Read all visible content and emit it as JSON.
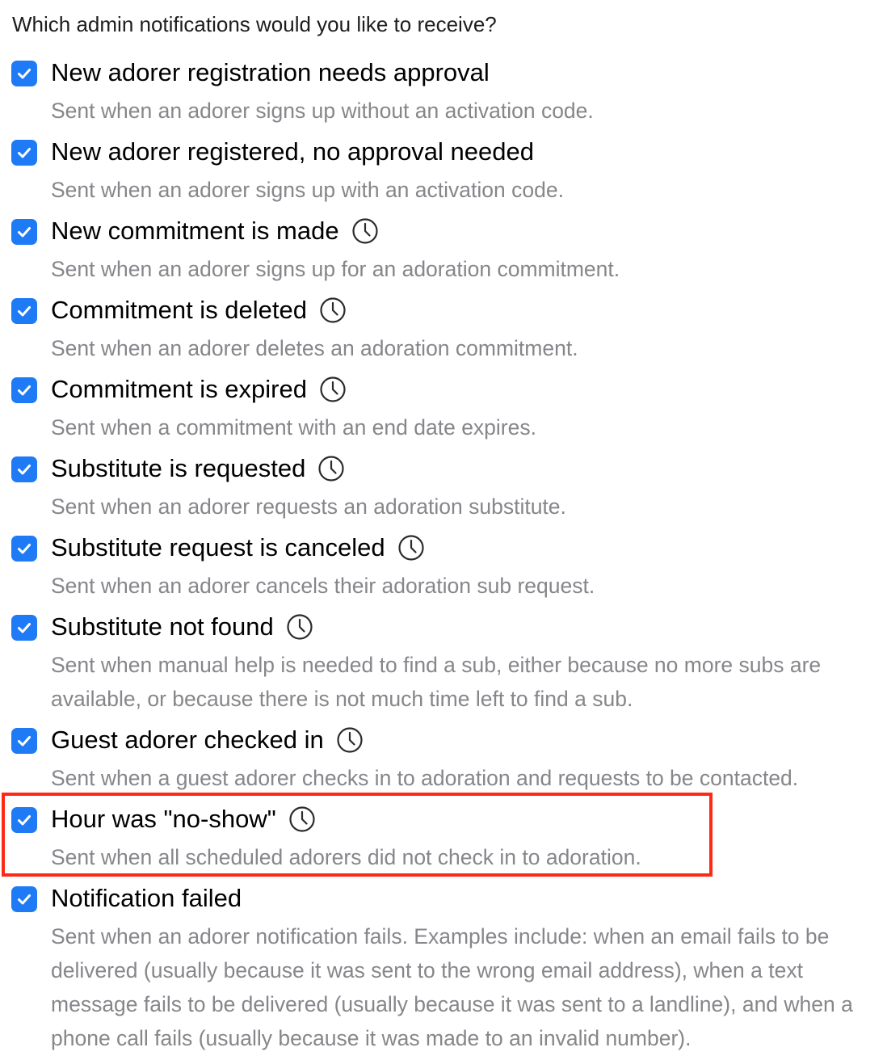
{
  "question": "Which admin notifications would you like to receive?",
  "colors": {
    "accent": "#1f7bf5",
    "highlight": "#ff2a14"
  },
  "items": [
    {
      "title": "New adorer registration needs approval",
      "checked": true,
      "clock_icon": false,
      "description": "Sent when an adorer signs up without an activation code."
    },
    {
      "title": "New adorer registered, no approval needed",
      "checked": true,
      "clock_icon": false,
      "description": "Sent when an adorer signs up with an activation code."
    },
    {
      "title": "New commitment is made",
      "checked": true,
      "clock_icon": true,
      "description": "Sent when an adorer signs up for an adoration commitment."
    },
    {
      "title": "Commitment is deleted",
      "checked": true,
      "clock_icon": true,
      "description": "Sent when an adorer deletes an adoration commitment."
    },
    {
      "title": "Commitment is expired",
      "checked": true,
      "clock_icon": true,
      "description": "Sent when a commitment with an end date expires."
    },
    {
      "title": "Substitute is requested",
      "checked": true,
      "clock_icon": true,
      "description": "Sent when an adorer requests an adoration substitute."
    },
    {
      "title": "Substitute request is canceled",
      "checked": true,
      "clock_icon": true,
      "description": "Sent when an adorer cancels their adoration sub request."
    },
    {
      "title": "Substitute not found",
      "checked": true,
      "clock_icon": true,
      "description": "Sent when manual help is needed to find a sub, either because no more subs are available, or because there is not much time left to find a sub."
    },
    {
      "title": "Guest adorer checked in",
      "checked": true,
      "clock_icon": true,
      "description": "Sent when a guest adorer checks in to adoration and requests to be contacted."
    },
    {
      "title": "Hour was \"no-show\"",
      "checked": true,
      "clock_icon": true,
      "highlighted": true,
      "description": "Sent when all scheduled adorers did not check in to adoration."
    },
    {
      "title": "Notification failed",
      "checked": true,
      "clock_icon": false,
      "description": "Sent when an adorer notification fails. Examples include: when an email fails to be delivered (usually because it was sent to the wrong email address), when a text message fails to be delivered (usually because it was sent to a landline), and when a phone call fails (usually because it was made to an invalid number)."
    }
  ]
}
